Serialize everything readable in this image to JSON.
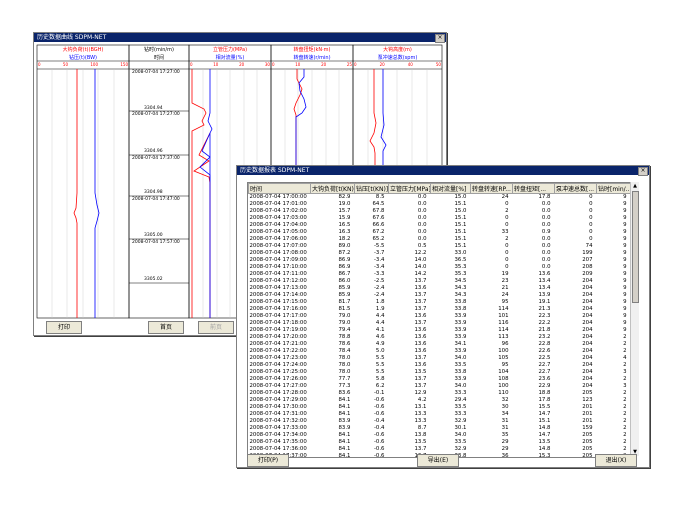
{
  "curve_window": {
    "title": "历史数据曲线    SDPM-NET",
    "close_glyph": "×",
    "track_headers": [
      {
        "top": "大钩负荷(t)(BGH)",
        "bottom": "钻压(t)(BW)",
        "top_ticks": [
          "0",
          "25",
          "50",
          "75",
          "100",
          "125",
          "150"
        ],
        "bottom_ticks": [
          "0",
          "5",
          "10",
          "15",
          "20",
          "25",
          "30"
        ]
      },
      {
        "top": "钻时(min/m)",
        "bottom": "时间",
        "top_ticks": [
          "0",
          "2",
          "4",
          "6",
          "8",
          "10",
          "12"
        ],
        "bottom_ticks": []
      },
      {
        "top": "立管压力(MPa)",
        "bottom": "相对流量(%)",
        "top_ticks": [
          "0",
          "5",
          "10",
          "15",
          "20",
          "25",
          "30"
        ],
        "bottom_ticks": [
          "0",
          "20",
          "40",
          "60",
          "80",
          "100"
        ]
      },
      {
        "top": "转盘扭矩(kN·m)",
        "bottom": "转盘转速(r/min)",
        "top_ticks": [
          "0",
          "5",
          "10",
          "15",
          "20",
          "25"
        ],
        "bottom_ticks": [
          "0",
          "50",
          "100",
          "150",
          "200",
          "250"
        ]
      },
      {
        "top": "大钩高度(m)",
        "bottom": "泵冲速总数(spm)",
        "top_ticks": [
          "0",
          "10",
          "20",
          "30",
          "40",
          "50"
        ],
        "bottom_ticks": [
          "0",
          "50",
          "100",
          "150",
          "200",
          "250"
        ]
      }
    ],
    "time_labels": [
      {
        "date": "2008-07-04 17:27:00",
        "depth": "3304.94"
      },
      {
        "date": "2008-07-04 17:27:00",
        "depth": "3304.96"
      },
      {
        "date": "2008-07-04 17:37:00",
        "depth": "3304.98"
      },
      {
        "date": "2008-07-04 17:47:00",
        "depth": "3305.00"
      },
      {
        "date": "2008-07-04 17:57:00",
        "depth": "3305.02"
      }
    ],
    "buttons": {
      "print": "打印",
      "first": "首页",
      "prev": "前页",
      "next": "后页",
      "export": "导出"
    }
  },
  "table_window": {
    "title": "历史数据报表    SDPM-NET",
    "close_glyph": "×",
    "columns": [
      "时间",
      "大钩负荷[t(KN)]",
      "钻压[t(KN)]",
      "立管压力[MPa]",
      "相对流量[%]",
      "转盘转速[RP...",
      "转盘扭矩[...",
      "泵冲速总数[...",
      "钻时[min/..."
    ],
    "rows": [
      [
        "2008-07-04 17:00:00",
        "82.9",
        "8.5",
        "0.0",
        "15.0",
        "24",
        "17.8",
        "0",
        "9"
      ],
      [
        "2008-07-04 17:01:00",
        "19.0",
        "64.5",
        "0.0",
        "15.1",
        "0",
        "0.0",
        "0",
        "9"
      ],
      [
        "2008-07-04 17:02:00",
        "15.7",
        "67.8",
        "0.0",
        "15.0",
        "2",
        "0.0",
        "0",
        "9"
      ],
      [
        "2008-07-04 17:03:00",
        "15.9",
        "67.6",
        "0.0",
        "15.1",
        "0",
        "0.0",
        "0",
        "9"
      ],
      [
        "2008-07-04 17:04:00",
        "16.5",
        "66.6",
        "0.0",
        "15.1",
        "0",
        "0.0",
        "0",
        "9"
      ],
      [
        "2008-07-04 17:05:00",
        "16.3",
        "67.2",
        "0.0",
        "15.1",
        "33",
        "0.9",
        "0",
        "9"
      ],
      [
        "2008-07-04 17:06:00",
        "18.2",
        "65.2",
        "0.0",
        "15.1",
        "2",
        "0.0",
        "0",
        "9"
      ],
      [
        "2008-07-04 17:07:00",
        "89.0",
        "-5.5",
        "0.5",
        "15.1",
        "0",
        "0.0",
        "74",
        "9"
      ],
      [
        "2008-07-04 17:08:00",
        "87.2",
        "-3.7",
        "12.2",
        "33.0",
        "0",
        "0.0",
        "199",
        "9"
      ],
      [
        "2008-07-04 17:09:00",
        "86.9",
        "-3.4",
        "14.0",
        "36.5",
        "0",
        "0.0",
        "207",
        "9"
      ],
      [
        "2008-07-04 17:10:00",
        "86.9",
        "-3.4",
        "14.0",
        "35.3",
        "0",
        "0.0",
        "208",
        "9"
      ],
      [
        "2008-07-04 17:11:00",
        "86.7",
        "-3.3",
        "14.2",
        "35.3",
        "19",
        "13.6",
        "209",
        "9"
      ],
      [
        "2008-07-04 17:12:00",
        "86.0",
        "-2.5",
        "13.7",
        "34.5",
        "23",
        "13.4",
        "204",
        "9"
      ],
      [
        "2008-07-04 17:13:00",
        "85.9",
        "-2.4",
        "13.6",
        "34.3",
        "21",
        "13.4",
        "204",
        "9"
      ],
      [
        "2008-07-04 17:14:00",
        "85.9",
        "-2.4",
        "13.7",
        "34.3",
        "24",
        "13.9",
        "204",
        "9"
      ],
      [
        "2008-07-04 17:15:00",
        "81.7",
        "1.8",
        "13.7",
        "33.8",
        "95",
        "19.1",
        "204",
        "9"
      ],
      [
        "2008-07-04 17:16:00",
        "81.5",
        "1.9",
        "13.7",
        "33.8",
        "114",
        "21.3",
        "204",
        "9"
      ],
      [
        "2008-07-04 17:17:00",
        "79.0",
        "4.4",
        "13.6",
        "33.9",
        "101",
        "22.3",
        "204",
        "9"
      ],
      [
        "2008-07-04 17:18:00",
        "79.0",
        "4.4",
        "13.7",
        "33.9",
        "116",
        "22.2",
        "204",
        "9"
      ],
      [
        "2008-07-04 17:19:00",
        "79.4",
        "4.1",
        "13.6",
        "33.9",
        "114",
        "21.8",
        "204",
        "9"
      ],
      [
        "2008-07-04 17:20:00",
        "78.8",
        "4.6",
        "13.6",
        "33.9",
        "113",
        "23.2",
        "204",
        "2"
      ],
      [
        "2008-07-04 17:21:00",
        "78.6",
        "4.9",
        "13.6",
        "34.1",
        "96",
        "22.8",
        "204",
        "2"
      ],
      [
        "2008-07-04 17:22:00",
        "78.4",
        "5.0",
        "13.6",
        "33.9",
        "100",
        "22.6",
        "204",
        "2"
      ],
      [
        "2008-07-04 17:23:00",
        "78.0",
        "5.5",
        "13.7",
        "34.0",
        "105",
        "22.5",
        "204",
        "4"
      ],
      [
        "2008-07-04 17:24:00",
        "78.0",
        "5.5",
        "13.6",
        "33.5",
        "95",
        "22.7",
        "204",
        "2"
      ],
      [
        "2008-07-04 17:25:00",
        "78.0",
        "5.5",
        "13.5",
        "33.8",
        "104",
        "22.7",
        "204",
        "3"
      ],
      [
        "2008-07-04 17:26:00",
        "77.7",
        "5.8",
        "13.7",
        "33.9",
        "108",
        "23.6",
        "204",
        "2"
      ],
      [
        "2008-07-04 17:27:00",
        "77.3",
        "6.2",
        "13.7",
        "34.0",
        "100",
        "22.9",
        "204",
        "3"
      ],
      [
        "2008-07-04 17:28:00",
        "83.6",
        "-0.1",
        "12.9",
        "33.3",
        "110",
        "18.8",
        "205",
        "2"
      ],
      [
        "2008-07-04 17:29:00",
        "84.1",
        "-0.6",
        "4.2",
        "29.4",
        "32",
        "17.8",
        "123",
        "2"
      ],
      [
        "2008-07-04 17:30:00",
        "84.1",
        "-0.6",
        "13.1",
        "33.5",
        "30",
        "15.5",
        "201",
        "2"
      ],
      [
        "2008-07-04 17:31:00",
        "84.1",
        "-0.6",
        "13.3",
        "33.3",
        "34",
        "14.7",
        "201",
        "2"
      ],
      [
        "2008-07-04 17:32:00",
        "83.9",
        "-0.4",
        "13.3",
        "32.9",
        "31",
        "15.1",
        "201",
        "2"
      ],
      [
        "2008-07-04 17:33:00",
        "83.9",
        "-0.4",
        "8.7",
        "30.1",
        "31",
        "14.8",
        "159",
        "2"
      ],
      [
        "2008-07-04 17:34:00",
        "84.1",
        "-0.6",
        "13.8",
        "34.0",
        "35",
        "14.7",
        "205",
        "2"
      ],
      [
        "2008-07-04 17:35:00",
        "84.1",
        "-0.6",
        "13.5",
        "33.5",
        "29",
        "13.5",
        "205",
        "2"
      ],
      [
        "2008-07-04 17:36:00",
        "84.1",
        "-0.6",
        "13.7",
        "32.9",
        "29",
        "14.8",
        "205",
        "2"
      ],
      [
        "2008-07-04 17:37:00",
        "84.1",
        "-0.6",
        "13.7",
        "33.8",
        "36",
        "15.3",
        "205",
        "2"
      ]
    ],
    "buttons": {
      "print": "打印(P)",
      "export": "导出(E)",
      "exit": "退出(X)"
    },
    "colors": {
      "title_bg": "#0a246a",
      "accent_red": "#ff0000",
      "accent_blue": "#0000ff"
    }
  }
}
